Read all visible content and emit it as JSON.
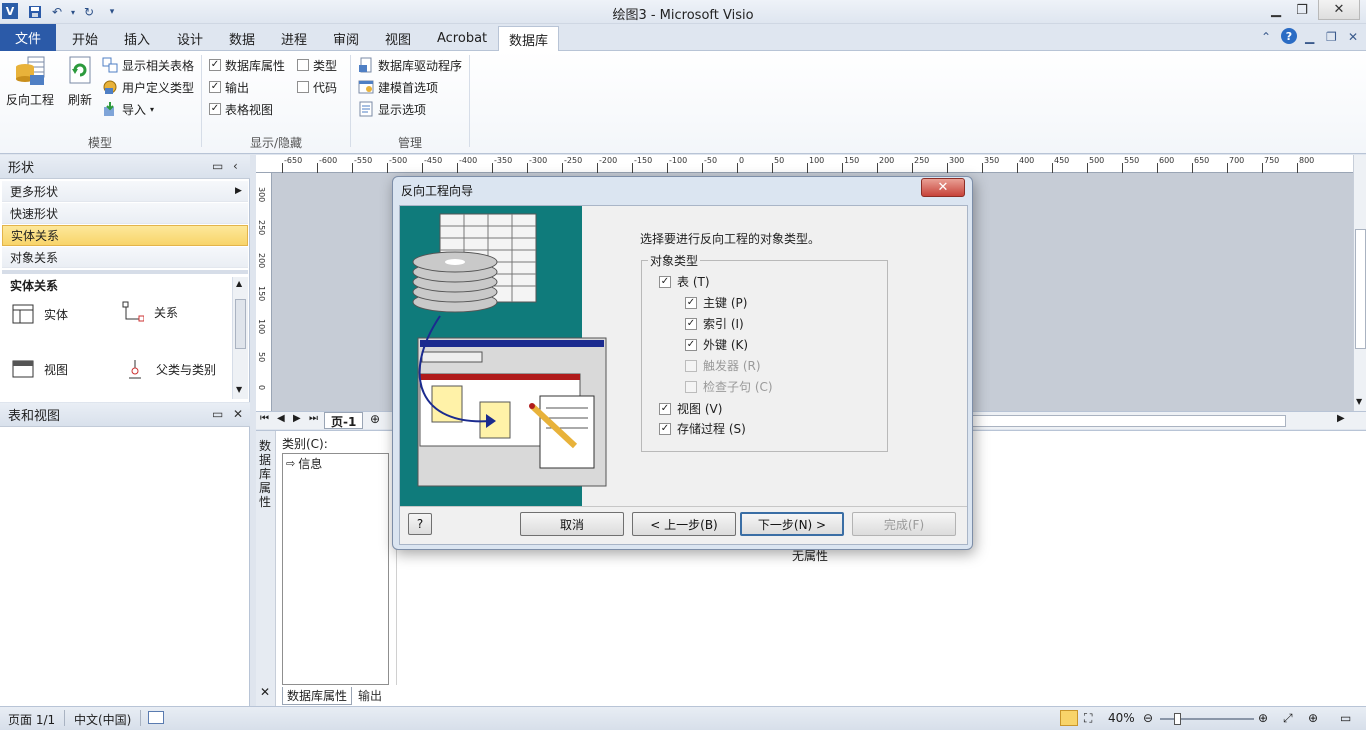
{
  "window": {
    "title": "绘图3 - Microsoft Visio",
    "app_icon": "V"
  },
  "tabs": [
    {
      "label": "文件"
    },
    {
      "label": "开始"
    },
    {
      "label": "插入"
    },
    {
      "label": "设计"
    },
    {
      "label": "数据"
    },
    {
      "label": "进程"
    },
    {
      "label": "审阅"
    },
    {
      "label": "视图"
    },
    {
      "label": "Acrobat"
    },
    {
      "label": "数据库"
    }
  ],
  "ribbon": {
    "model": {
      "label": "模型",
      "reverse_engineer": "反向工程",
      "refresh": "刷新",
      "show_related_tables": "显示相关表格",
      "user_defined_types": "用户定义类型",
      "import": "导入"
    },
    "show_hide": {
      "label": "显示/隐藏",
      "database_properties": "数据库属性",
      "output": "输出",
      "tables_views": "表格视图",
      "types": "类型",
      "code": "代码"
    },
    "manage": {
      "label": "管理",
      "drivers": "数据库驱动程序",
      "modeling_prefs": "建模首选项",
      "display_options": "显示选项"
    }
  },
  "shapes_pane": {
    "title": "形状",
    "more_shapes": "更多形状",
    "quick_shapes": "快速形状",
    "entity_relationship": "实体关系",
    "object_relational": "对象关系",
    "stencil_title": "实体关系",
    "shapes": [
      {
        "label": "实体"
      },
      {
        "label": "关系"
      },
      {
        "label": "视图"
      },
      {
        "label": "父类与类别"
      }
    ]
  },
  "tables_views_pane": {
    "title": "表和视图"
  },
  "ruler_labels": [
    "-650",
    "-600",
    "-550",
    "-500",
    "-450",
    "-400",
    "-350",
    "-300",
    "-250",
    "-200",
    "-150",
    "-100",
    "-50",
    "0",
    "50",
    "100",
    "150",
    "200",
    "250",
    "300",
    "350",
    "400",
    "450",
    "500",
    "550",
    "600",
    "650",
    "700",
    "750",
    "800"
  ],
  "left_ruler_labels": [
    "300",
    "250",
    "200",
    "150",
    "100",
    "50",
    "0"
  ],
  "page_tabs": {
    "page": "页-1"
  },
  "output": {
    "side_title": "数据库属性",
    "category_label": "类别(C):",
    "categories": [
      "信息"
    ],
    "no_properties": "无属性",
    "tab_db_props": "数据库属性",
    "tab_output": "输出"
  },
  "dialog": {
    "title": "反向工程向导",
    "prompt": "选择要进行反向工程的对象类型。",
    "group_label": "对象类型",
    "items": [
      {
        "label": "表 (T)",
        "checked": true,
        "disabled": false
      },
      {
        "label": "主键 (P)",
        "checked": true,
        "disabled": false
      },
      {
        "label": "索引 (I)",
        "checked": true,
        "disabled": false
      },
      {
        "label": "外键 (K)",
        "checked": true,
        "disabled": false
      },
      {
        "label": "触发器 (R)",
        "checked": false,
        "disabled": true
      },
      {
        "label": "检查子句 (C)",
        "checked": false,
        "disabled": true
      },
      {
        "label": "视图 (V)",
        "checked": true,
        "disabled": false
      },
      {
        "label": "存储过程 (S)",
        "checked": true,
        "disabled": false
      }
    ],
    "buttons": {
      "help": "?",
      "cancel": "取消",
      "back": "< 上一步(B)",
      "next": "下一步(N) >",
      "finish": "完成(F)"
    }
  },
  "statusbar": {
    "page": "页面 1/1",
    "language": "中文(中国)",
    "zoom": "40%"
  },
  "colors": {
    "accent": "#2b5aa8",
    "art_bg": "#0f7b7b",
    "active_stencil": "#f8d46a"
  }
}
